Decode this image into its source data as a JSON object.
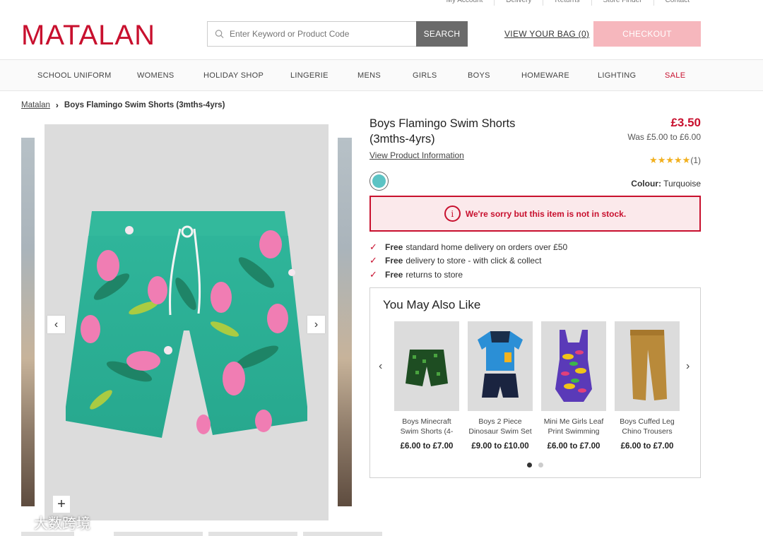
{
  "utility_links": [
    "My Account",
    "Delivery",
    "Returns",
    "Store Finder",
    "Contact"
  ],
  "header": {
    "logo": "MATALAN",
    "search_placeholder": "Enter Keyword or Product Code",
    "search_button": "SEARCH",
    "bag_link": "VIEW YOUR BAG (0)",
    "checkout_button": "CHECKOUT"
  },
  "nav": [
    "SCHOOL UNIFORM",
    "WOMENS",
    "HOLIDAY SHOP",
    "LINGERIE",
    "MENS",
    "GIRLS",
    "BOYS",
    "HOMEWARE",
    "LIGHTING",
    "SALE"
  ],
  "breadcrumb": {
    "home": "Matalan",
    "current": "Boys Flamingo Swim Shorts (3mths-4yrs)"
  },
  "product": {
    "title_line1": "Boys Flamingo Swim Shorts",
    "title_line2": "(3mths-4yrs)",
    "info_link": "View Product Information",
    "price": "£3.50",
    "was_price": "Was £5.00 to £6.00",
    "rating": 5,
    "rating_count": "(1)",
    "colour_label": "Colour:",
    "colour_value": "Turquoise",
    "swatch_color": "#5cc3c4",
    "stock_message": "We're sorry but this item is not in stock."
  },
  "benefits": [
    {
      "bold": "Free",
      "text": "standard home delivery on orders over £50"
    },
    {
      "bold": "Free",
      "text": "delivery to store - with click & collect"
    },
    {
      "bold": "Free",
      "text": "returns to store"
    }
  ],
  "ymal": {
    "heading": "You May Also Like",
    "items": [
      {
        "name": "Boys Minecraft Swim Shorts (4-",
        "price": "£6.00 to £7.00"
      },
      {
        "name": "Boys 2 Piece Dinosaur Swim Set",
        "price": "£9.00 to £10.00"
      },
      {
        "name": "Mini Me Girls Leaf Print Swimming",
        "price": "£6.00 to £7.00"
      },
      {
        "name": "Boys Cuffed Leg Chino Trousers",
        "price": "£6.00 to £7.00"
      }
    ]
  },
  "watermark": "大数跨境",
  "colors": {
    "brand_red": "#c8102e",
    "checkout_pink": "#f6b7bd",
    "search_grey": "#6b6b6b"
  }
}
